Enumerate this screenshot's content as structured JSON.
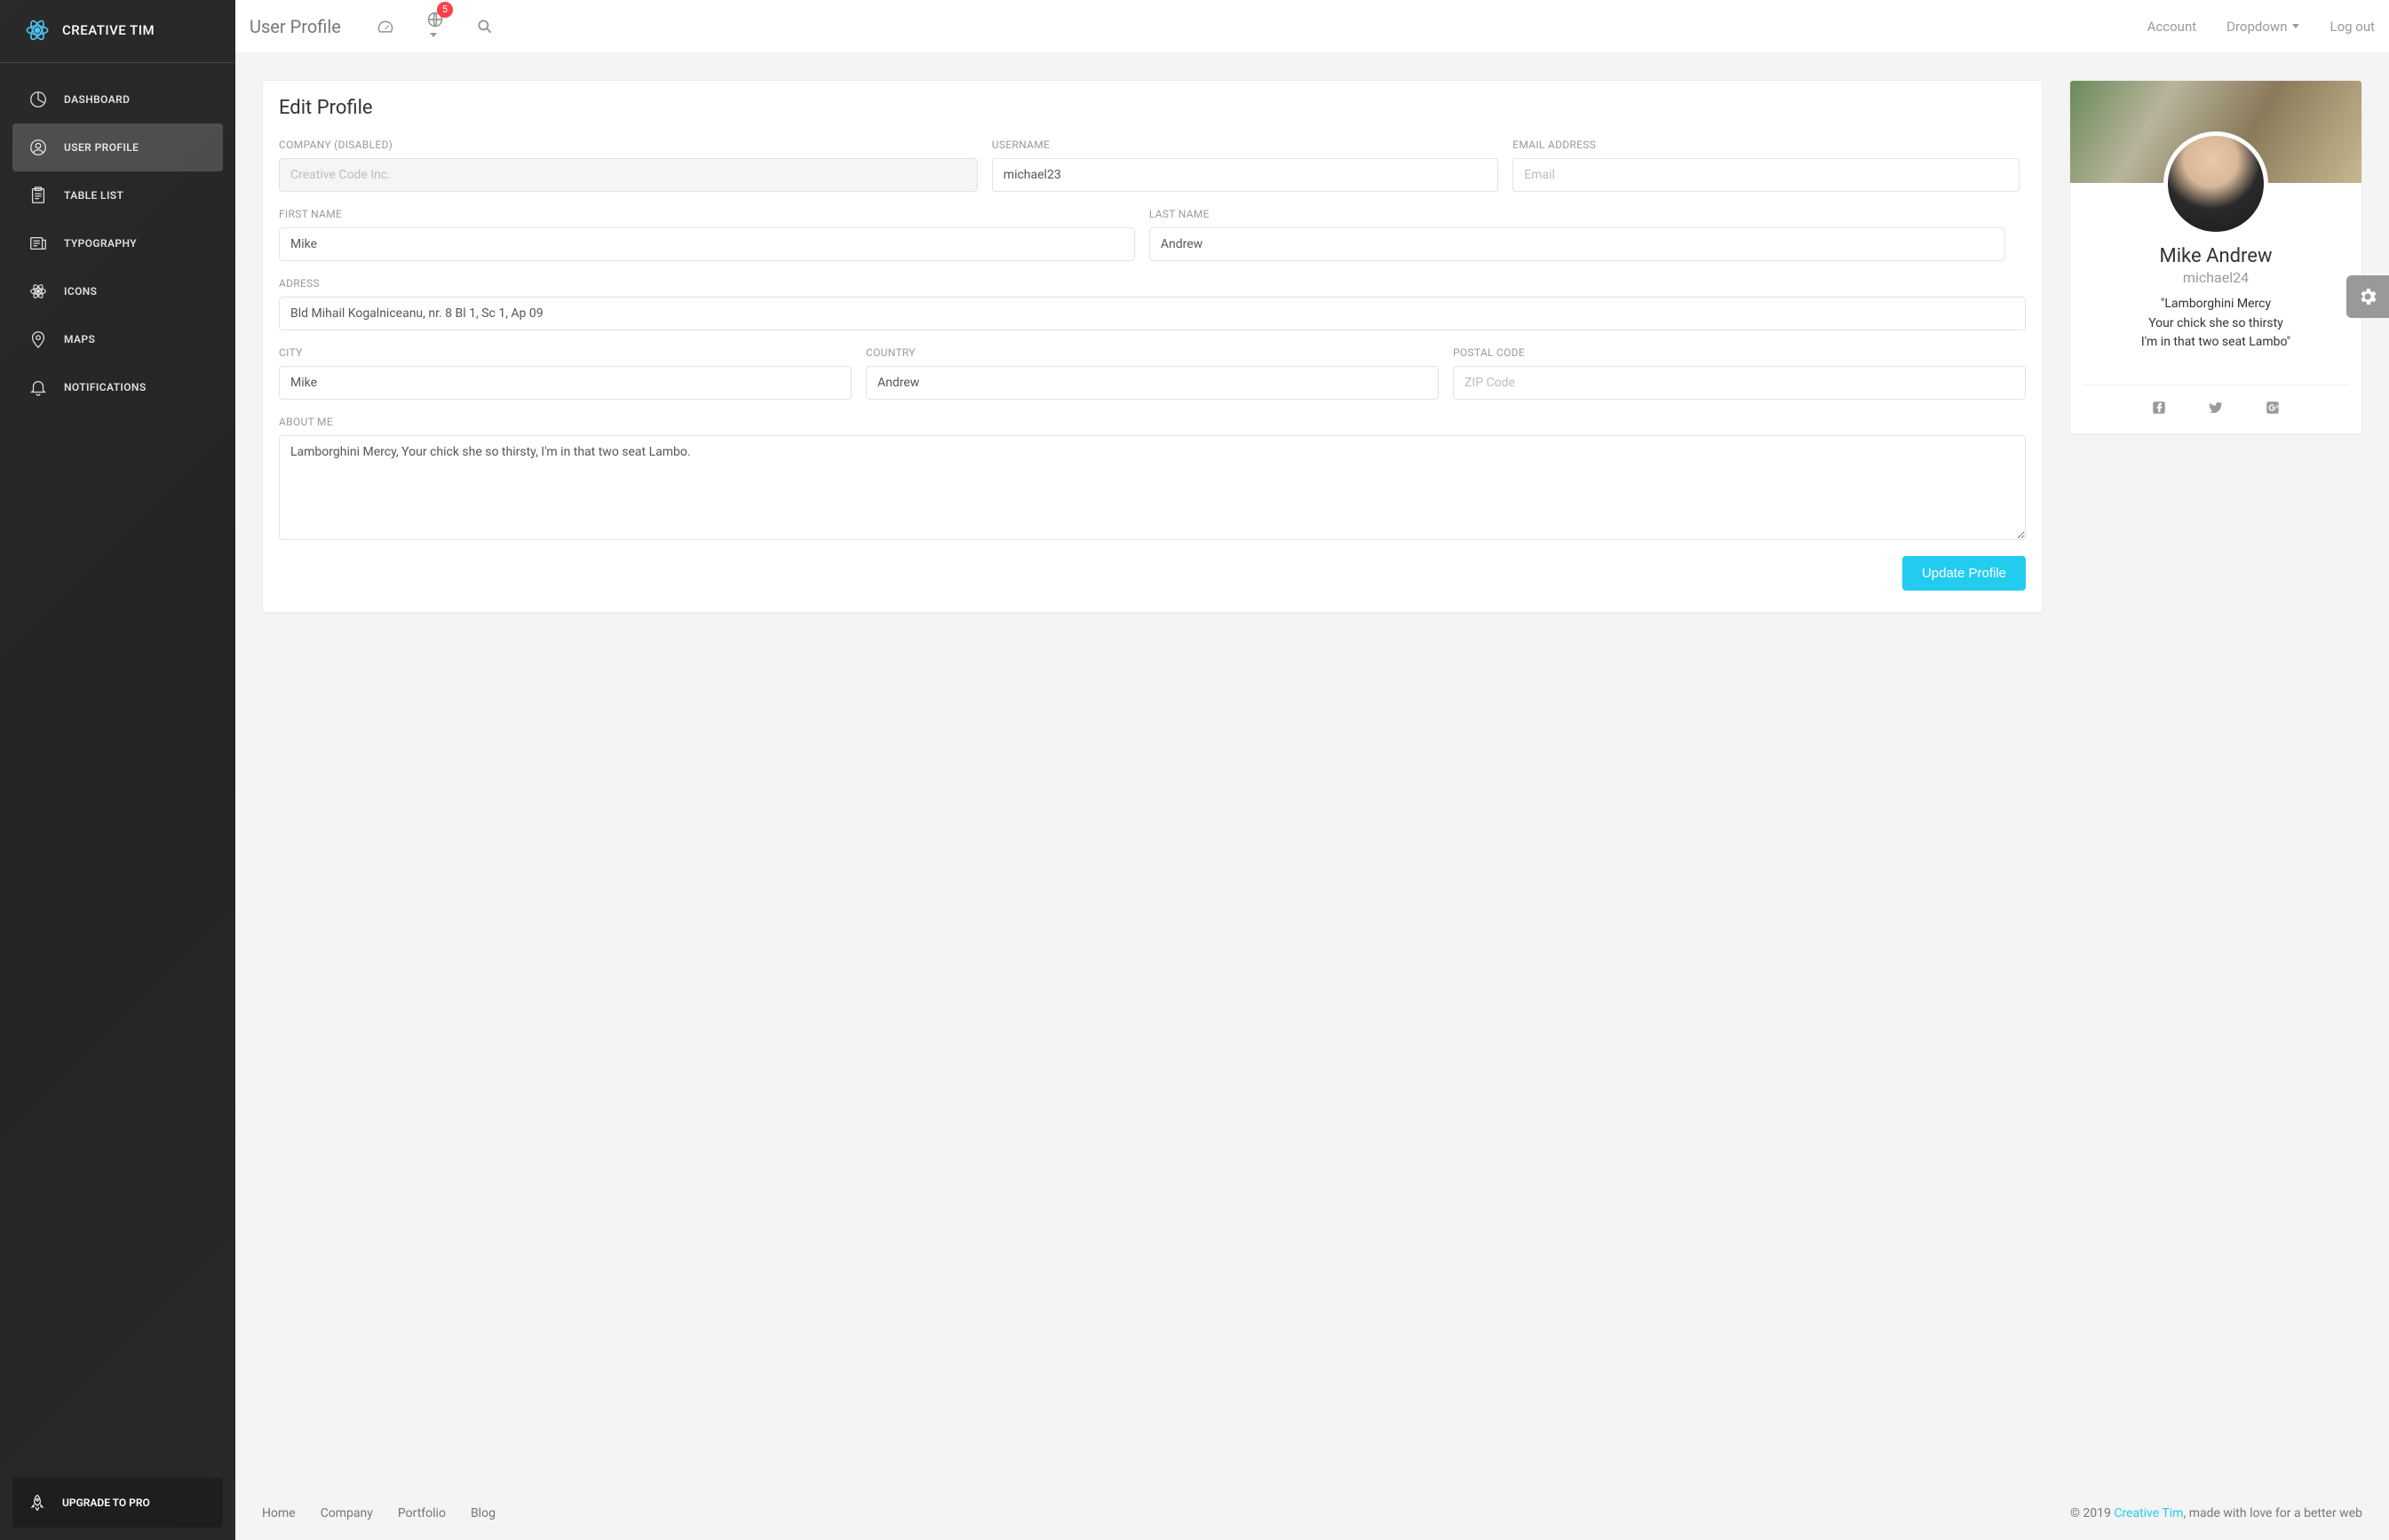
{
  "brand": "CREATIVE TIM",
  "page_title": "User Profile",
  "topbar": {
    "notifications_badge": "5",
    "right": {
      "account": "Account",
      "dropdown": "Dropdown",
      "logout": "Log out"
    }
  },
  "sidebar": {
    "items": [
      {
        "label": "DASHBOARD"
      },
      {
        "label": "USER PROFILE"
      },
      {
        "label": "TABLE LIST"
      },
      {
        "label": "TYPOGRAPHY"
      },
      {
        "label": "ICONS"
      },
      {
        "label": "MAPS"
      },
      {
        "label": "NOTIFICATIONS"
      }
    ],
    "upgrade": "UPGRADE TO PRO"
  },
  "form": {
    "title": "Edit Profile",
    "labels": {
      "company": "COMPANY (DISABLED)",
      "username": "USERNAME",
      "email": "EMAIL ADDRESS",
      "first_name": "FIRST NAME",
      "last_name": "LAST NAME",
      "address": "ADRESS",
      "city": "CITY",
      "country": "COUNTRY",
      "postal": "POSTAL CODE",
      "about": "ABOUT ME"
    },
    "placeholders": {
      "company": "Creative Code Inc.",
      "email": "Email",
      "postal": "ZIP Code"
    },
    "values": {
      "username": "michael23",
      "email": "",
      "first_name": "Mike",
      "last_name": "Andrew",
      "address": "Bld Mihail Kogalniceanu, nr. 8 Bl 1, Sc 1, Ap 09",
      "city": "Mike",
      "country": "Andrew",
      "postal": "",
      "about": "Lamborghini Mercy, Your chick she so thirsty, I'm in that two seat Lambo."
    },
    "submit": "Update Profile"
  },
  "profile": {
    "name": "Mike Andrew",
    "handle": "michael24",
    "quote_l1": "\"Lamborghini Mercy",
    "quote_l2": "Your chick she so thirsty",
    "quote_l3": "I'm in that two seat Lambo\""
  },
  "footer": {
    "links": [
      "Home",
      "Company",
      "Portfolio",
      "Blog"
    ],
    "copyright_prefix": "© 2019 ",
    "copyright_link": "Creative Tim",
    "copyright_suffix": ", made with love for a better web"
  }
}
